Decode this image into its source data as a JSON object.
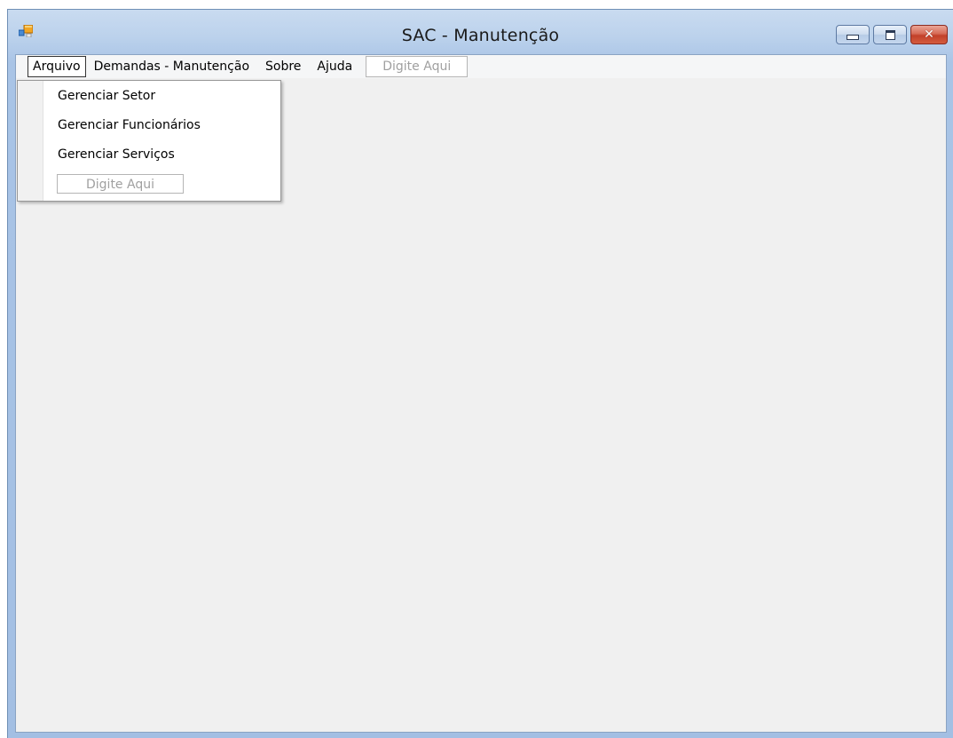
{
  "window": {
    "title": "SAC - Manutenção",
    "icon": "app-form-icon",
    "controls": {
      "minimize": "minimize-icon",
      "maximize": "maximize-icon",
      "close_glyph": "✕"
    }
  },
  "menubar": {
    "items": [
      {
        "label": "Arquivo"
      },
      {
        "label": "Demandas - Manutenção"
      },
      {
        "label": "Sobre"
      },
      {
        "label": "Ajuda"
      }
    ],
    "placeholder": "Digite Aqui"
  },
  "dropdown": {
    "items": [
      {
        "label": "Gerenciar Setor"
      },
      {
        "label": "Gerenciar Funcionários"
      },
      {
        "label": "Gerenciar Serviços"
      }
    ],
    "placeholder": "Digite Aqui"
  },
  "colors": {
    "titlebar": "#bcd2ec",
    "client": "#f0f0f0",
    "close_button": "#c2402a"
  }
}
